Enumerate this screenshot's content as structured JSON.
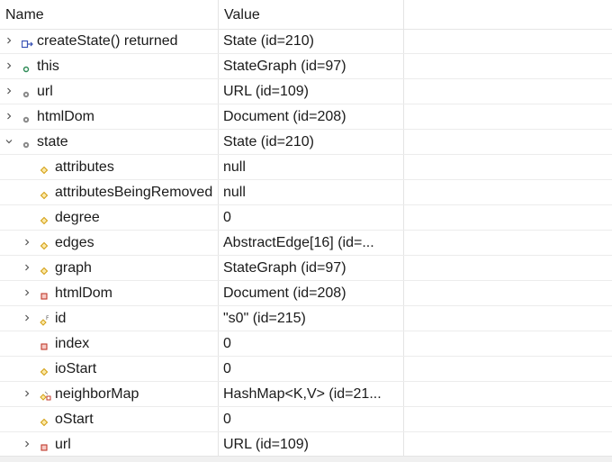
{
  "header": {
    "name_label": "Name",
    "value_label": "Value"
  },
  "rows": [
    {
      "name": "createState() returned",
      "value": "State  (id=210)",
      "icon": "return-value-icon",
      "level": 0,
      "toggle": "collapsed"
    },
    {
      "name": "this",
      "value": "StateGraph  (id=97)",
      "icon": "local-variable-icon",
      "level": 0,
      "toggle": "collapsed"
    },
    {
      "name": "url",
      "value": "URL  (id=109)",
      "icon": "parameter-icon",
      "level": 0,
      "toggle": "collapsed"
    },
    {
      "name": "htmlDom",
      "value": "Document  (id=208)",
      "icon": "parameter-icon",
      "level": 0,
      "toggle": "collapsed"
    },
    {
      "name": "state",
      "value": "State  (id=210)",
      "icon": "parameter-icon",
      "level": 0,
      "toggle": "expanded"
    },
    {
      "name": "attributes",
      "value": "null",
      "icon": "protected-field-icon",
      "level": 1,
      "toggle": "none"
    },
    {
      "name": "attributesBeingRemoved",
      "value": "null",
      "icon": "protected-field-icon",
      "level": 1,
      "toggle": "none"
    },
    {
      "name": "degree",
      "value": "0",
      "icon": "protected-field-icon",
      "level": 1,
      "toggle": "none"
    },
    {
      "name": "edges",
      "value": "AbstractEdge[16]  (id=...",
      "icon": "protected-field-icon",
      "level": 1,
      "toggle": "collapsed"
    },
    {
      "name": "graph",
      "value": "StateGraph  (id=97)",
      "icon": "protected-field-icon",
      "level": 1,
      "toggle": "collapsed"
    },
    {
      "name": "htmlDom",
      "value": "Document  (id=208)",
      "icon": "private-field-icon",
      "level": 1,
      "toggle": "collapsed"
    },
    {
      "name": "id",
      "value": "\"s0\" (id=215)",
      "icon": "final-field-icon",
      "level": 1,
      "toggle": "collapsed"
    },
    {
      "name": "index",
      "value": "0",
      "icon": "private-field-icon",
      "level": 1,
      "toggle": "none"
    },
    {
      "name": "ioStart",
      "value": "0",
      "icon": "protected-field-icon",
      "level": 1,
      "toggle": "none"
    },
    {
      "name": "neighborMap",
      "value": "HashMap<K,V>  (id=21...",
      "icon": "generic-field-icon",
      "level": 1,
      "toggle": "collapsed"
    },
    {
      "name": "oStart",
      "value": "0",
      "icon": "protected-field-icon",
      "level": 1,
      "toggle": "none"
    },
    {
      "name": "url",
      "value": "URL  (id=109)",
      "icon": "private-field-icon",
      "level": 1,
      "toggle": "collapsed"
    }
  ],
  "colors": {
    "return_icon": "#3b54b5",
    "local_icon": "#2e8b57",
    "parameter_icon": "#8a8a8a",
    "protected_icon": "#d4a017",
    "private_icon": "#c0392b"
  }
}
